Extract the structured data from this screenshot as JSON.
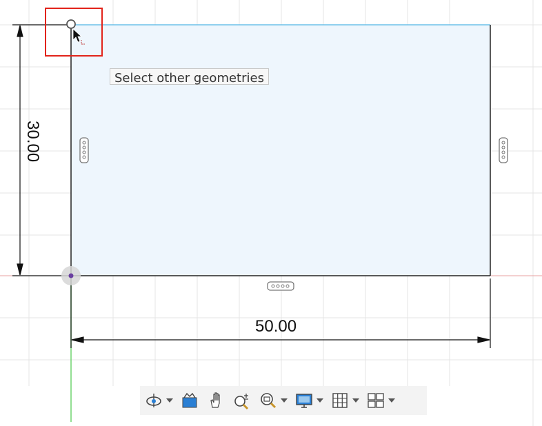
{
  "tooltip": {
    "text": "Select other geometries"
  },
  "dimensions": {
    "horizontal": "50.00",
    "vertical": "30.00"
  },
  "colors": {
    "sketch_fill": "#eef6fd",
    "top_edge": "#6cc0e8",
    "axis_x": "#e8a0a0",
    "axis_y": "#6fd36f",
    "highlight": "#e2231a"
  },
  "toolbar": {
    "items": [
      {
        "icon": "orbit-icon",
        "has_menu": true
      },
      {
        "icon": "look-at-icon",
        "has_menu": false
      },
      {
        "icon": "pan-hand-icon",
        "has_menu": false
      },
      {
        "icon": "zoom-icon",
        "has_menu": false
      },
      {
        "icon": "fit-window-icon",
        "has_menu": true
      },
      {
        "icon": "display-settings-icon",
        "has_menu": true
      },
      {
        "icon": "grid-icon",
        "has_menu": true
      },
      {
        "icon": "viewports-icon",
        "has_menu": true
      }
    ]
  }
}
